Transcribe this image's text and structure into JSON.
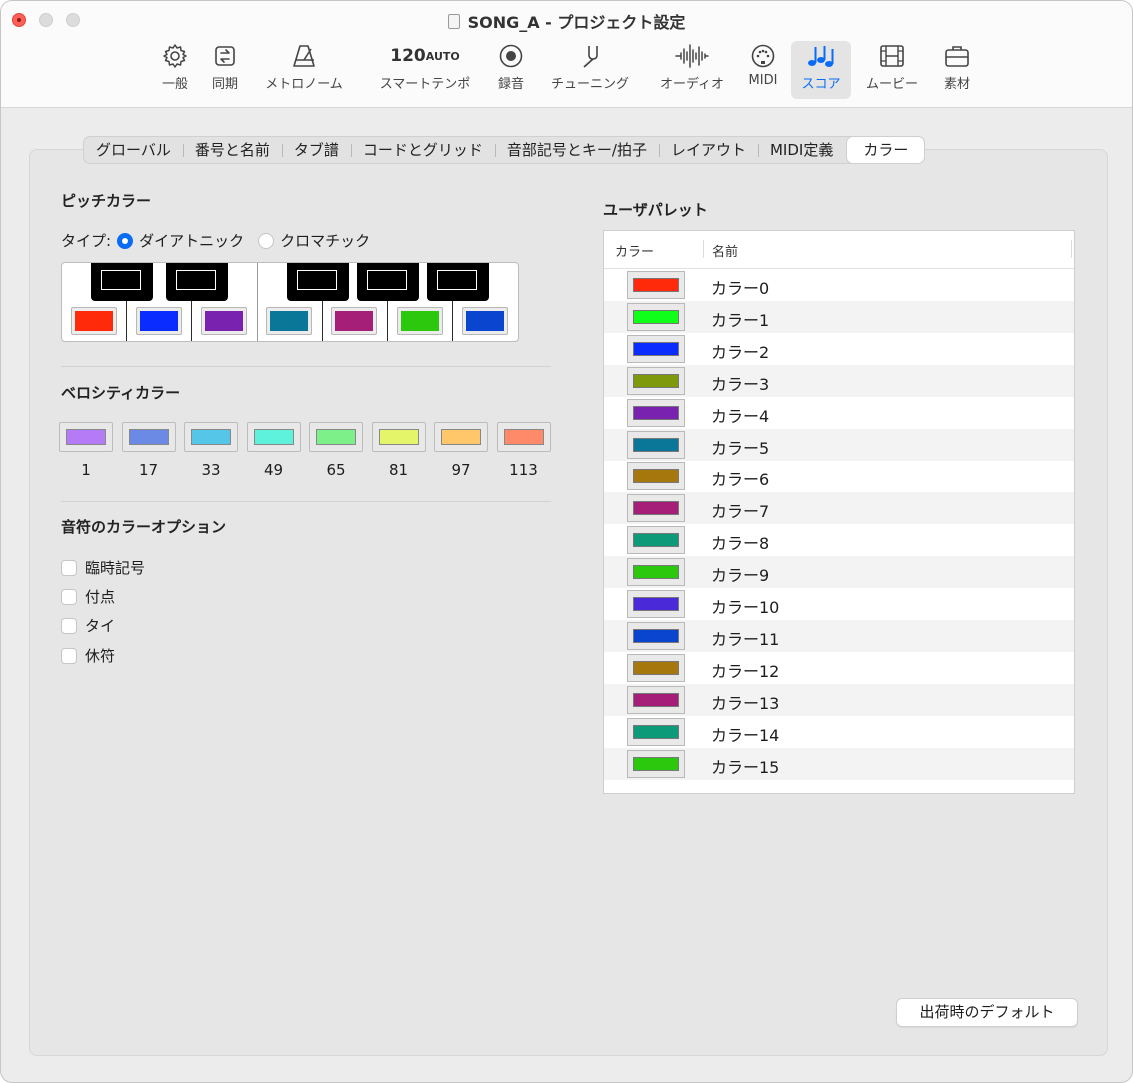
{
  "window": {
    "title": "SONG_A - プロジェクト設定"
  },
  "toolbar": {
    "items": [
      {
        "label": "一般",
        "icon": "gear-icon"
      },
      {
        "label": "同期",
        "icon": "sync-icon"
      },
      {
        "label": "メトロノーム",
        "icon": "metronome-icon"
      },
      {
        "label": "スマートテンポ",
        "icon": "tempo-display",
        "tempo": "120",
        "mode": "AUTO"
      },
      {
        "label": "録音",
        "icon": "record-icon"
      },
      {
        "label": "チューニング",
        "icon": "tuning-fork-icon"
      },
      {
        "label": "オーディオ",
        "icon": "waveform-icon"
      },
      {
        "label": "MIDI",
        "icon": "midi-port-icon"
      },
      {
        "label": "スコア",
        "icon": "notes-icon",
        "active": true
      },
      {
        "label": "ムービー",
        "icon": "film-icon"
      },
      {
        "label": "素材",
        "icon": "briefcase-icon"
      }
    ]
  },
  "tabs": [
    "グローバル",
    "番号と名前",
    "タブ譜",
    "コードとグリッド",
    "音部記号とキー/拍子",
    "レイアウト",
    "MIDI定義",
    "カラー"
  ],
  "active_tab": "カラー",
  "pitch": {
    "title": "ピッチカラー",
    "type_label": "タイプ:",
    "option_diatonic": "ダイアトニック",
    "option_chromatic": "クロマチック",
    "selected": "ダイアトニック",
    "white_key_colors": [
      "#ff2a0a",
      "#0a2cff",
      "#7a22b0",
      "#0a7799",
      "#a51e78",
      "#2bc80e",
      "#0a45d0"
    ]
  },
  "velocity": {
    "title": "ベロシティカラー",
    "values": [
      "1",
      "17",
      "33",
      "49",
      "65",
      "81",
      "97",
      "113"
    ],
    "colors": [
      "#b57af5",
      "#6a8ae6",
      "#55c6e8",
      "#5ef2dc",
      "#7ef08a",
      "#e4f56a",
      "#ffc76a",
      "#ff8a6a"
    ]
  },
  "note_options": {
    "title": "音符のカラーオプション",
    "items": [
      "臨時記号",
      "付点",
      "タイ",
      "休符"
    ]
  },
  "user_palette": {
    "title": "ユーザパレット",
    "col_color": "カラー",
    "col_name": "名前",
    "rows": [
      {
        "name": "カラー0",
        "color": "#ff2a0a"
      },
      {
        "name": "カラー1",
        "color": "#10ff1a"
      },
      {
        "name": "カラー2",
        "color": "#0a2cff"
      },
      {
        "name": "カラー3",
        "color": "#7e9a0c"
      },
      {
        "name": "カラー4",
        "color": "#7a22b0"
      },
      {
        "name": "カラー5",
        "color": "#0a7799"
      },
      {
        "name": "カラー6",
        "color": "#a6770c"
      },
      {
        "name": "カラー7",
        "color": "#a51e78"
      },
      {
        "name": "カラー8",
        "color": "#0c9a78"
      },
      {
        "name": "カラー9",
        "color": "#2bc80e"
      },
      {
        "name": "カラー10",
        "color": "#4a2ad8"
      },
      {
        "name": "カラー11",
        "color": "#0a45d0"
      },
      {
        "name": "カラー12",
        "color": "#a6770c"
      },
      {
        "name": "カラー13",
        "color": "#a51e78"
      },
      {
        "name": "カラー14",
        "color": "#0c9a78"
      },
      {
        "name": "カラー15",
        "color": "#2bc80e"
      }
    ]
  },
  "default_button": "出荷時のデフォルト"
}
